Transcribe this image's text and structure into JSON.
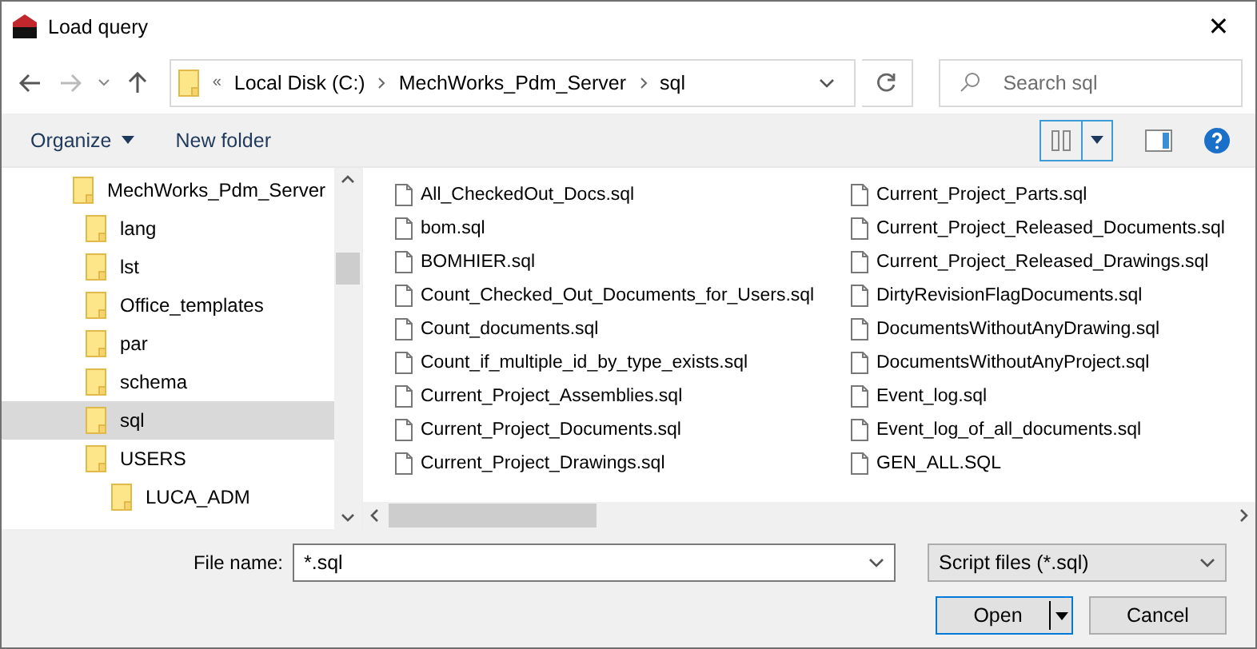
{
  "window": {
    "title": "Load query",
    "close": "✕"
  },
  "address": {
    "overflow": "«",
    "crumbs": [
      "Local Disk (C:)",
      "MechWorks_Pdm_Server",
      "sql"
    ]
  },
  "search": {
    "placeholder": "Search sql"
  },
  "toolbar": {
    "organize": "Organize",
    "new_folder": "New folder"
  },
  "tree": [
    {
      "label": "MechWorks_Pdm_Server",
      "selected": false,
      "children": [
        {
          "label": "lang",
          "selected": false
        },
        {
          "label": "lst",
          "selected": false
        },
        {
          "label": "Office_templates",
          "selected": false
        },
        {
          "label": "par",
          "selected": false
        },
        {
          "label": "schema",
          "selected": false
        },
        {
          "label": "sql",
          "selected": true
        },
        {
          "label": "USERS",
          "selected": false,
          "children": [
            {
              "label": "LUCA_ADM",
              "selected": false
            }
          ]
        }
      ]
    }
  ],
  "files": [
    "All_CheckedOut_Docs.sql",
    "bom.sql",
    "BOMHIER.sql",
    "Count_Checked_Out_Documents_for_Users.sql",
    "Count_documents.sql",
    "Count_if_multiple_id_by_type_exists.sql",
    "Current_Project_Assemblies.sql",
    "Current_Project_Documents.sql",
    "Current_Project_Drawings.sql",
    "Current_Project_Parts.sql",
    "Current_Project_Released_Documents.sql",
    "Current_Project_Released_Drawings.sql",
    "DirtyRevisionFlagDocuments.sql",
    "DocumentsWithoutAnyDrawing.sql",
    "DocumentsWithoutAnyProject.sql",
    "Event_log.sql",
    "Event_log_of_all_documents.sql",
    "GEN_ALL.SQL"
  ],
  "file_name": {
    "label": "File name:",
    "value": "*.sql"
  },
  "file_type": {
    "value": "Script files (*.sql)"
  },
  "buttons": {
    "open": "Open",
    "cancel": "Cancel"
  }
}
